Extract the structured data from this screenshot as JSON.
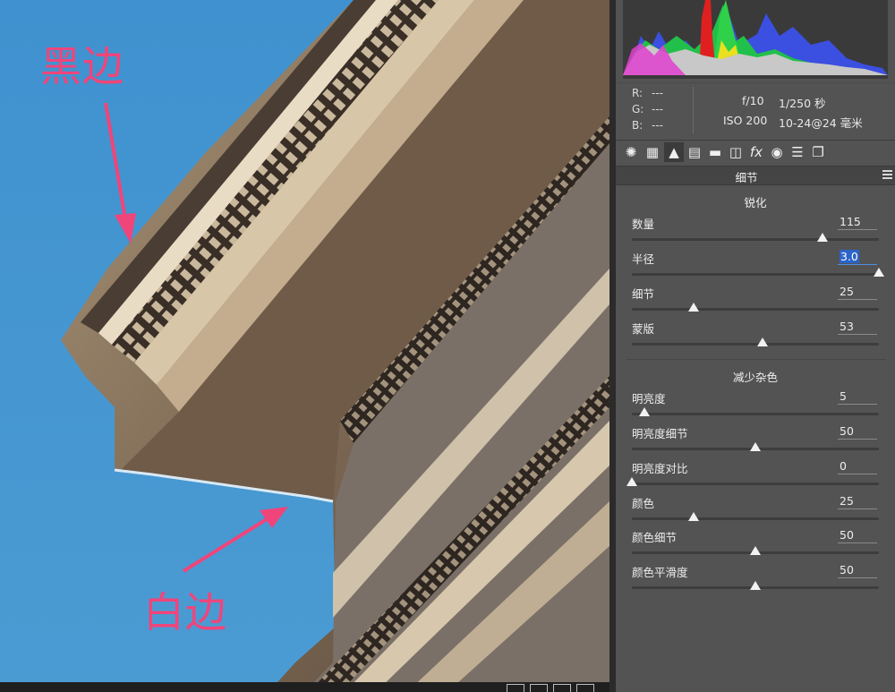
{
  "annotations": {
    "black_edge": "黑边",
    "white_edge": "白边",
    "color": "#f0457a"
  },
  "readout": {
    "r_label": "R:",
    "r_value": "---",
    "g_label": "G:",
    "g_value": "---",
    "b_label": "B:",
    "b_value": "---",
    "aperture": "f/10",
    "shutter": "1/250 秒",
    "iso": "ISO 200",
    "lens": "10-24@24 毫米"
  },
  "tabs": [
    {
      "icon": "aperture-icon"
    },
    {
      "icon": "grid-icon"
    },
    {
      "icon": "mountain-icon",
      "active": true
    },
    {
      "icon": "split-toning-icon"
    },
    {
      "icon": "hsl-icon"
    },
    {
      "icon": "lens-icon"
    },
    {
      "icon": "fx-icon",
      "label": "fx"
    },
    {
      "icon": "camera-icon"
    },
    {
      "icon": "sliders-icon"
    },
    {
      "icon": "presets-icon"
    }
  ],
  "panel": {
    "section_title": "细节",
    "sharpening": {
      "title": "锐化",
      "sliders": [
        {
          "label": "数量",
          "value": "115",
          "fraction": 0.77
        },
        {
          "label": "半径",
          "value": "3.0",
          "fraction": 1.0,
          "selected": true
        },
        {
          "label": "细节",
          "value": "25",
          "fraction": 0.25
        },
        {
          "label": "蒙版",
          "value": "53",
          "fraction": 0.53
        }
      ]
    },
    "noise": {
      "title": "减少杂色",
      "sliders": [
        {
          "label": "明亮度",
          "value": "5",
          "fraction": 0.05
        },
        {
          "label": "明亮度细节",
          "value": "50",
          "fraction": 0.5
        },
        {
          "label": "明亮度对比",
          "value": "0",
          "fraction": 0.0
        },
        {
          "label": "颜色",
          "value": "25",
          "fraction": 0.25
        },
        {
          "label": "颜色细节",
          "value": "50",
          "fraction": 0.5
        },
        {
          "label": "颜色平滑度",
          "value": "50",
          "fraction": 0.5
        }
      ]
    }
  }
}
